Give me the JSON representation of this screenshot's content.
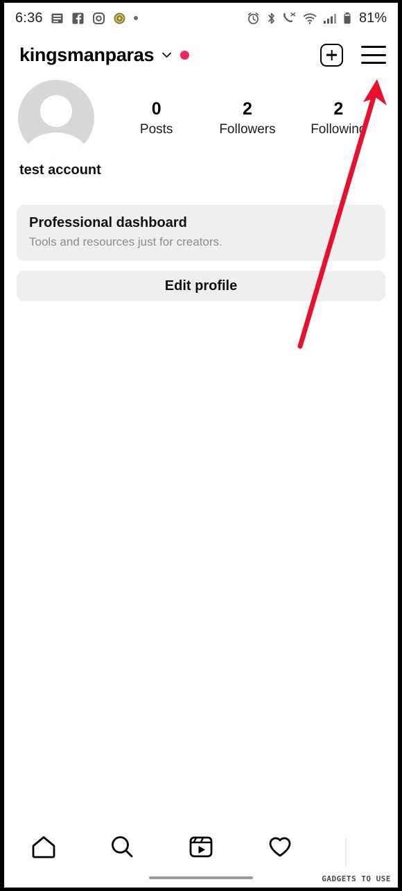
{
  "status_bar": {
    "time": "6:36",
    "notification_icons": [
      "messages-icon",
      "facebook-icon",
      "instagram-icon",
      "coin-icon",
      "more-dot-icon"
    ],
    "right_icons": [
      "alarm-icon",
      "bluetooth-icon",
      "call-mute-icon",
      "wifi-icon",
      "signal-icon",
      "battery-icon"
    ],
    "battery_percent": "81%"
  },
  "header": {
    "username": "kingsmanparas",
    "chevron_icon": "chevron-down-icon",
    "badge_color": "#F5245E",
    "create_icon": "plus-square-icon",
    "menu_icon": "hamburger-menu-icon"
  },
  "profile": {
    "avatar_icon": "default-avatar-icon",
    "full_name": "test account",
    "stats": [
      {
        "value": "0",
        "label": "Posts"
      },
      {
        "value": "2",
        "label": "Followers"
      },
      {
        "value": "2",
        "label": "Following"
      }
    ]
  },
  "dashboard_card": {
    "title": "Professional dashboard",
    "subtitle": "Tools and resources just for creators."
  },
  "edit_profile_button": {
    "label": "Edit profile"
  },
  "bottom_nav": {
    "items": [
      {
        "name": "home-icon"
      },
      {
        "name": "search-icon"
      },
      {
        "name": "reels-icon"
      },
      {
        "name": "heart-icon"
      },
      {
        "name": "profile-tab"
      }
    ]
  },
  "annotation": {
    "arrow_color": "#E8112D",
    "target": "hamburger-menu-icon"
  },
  "watermark": {
    "text": "GADGETS TO USE"
  }
}
